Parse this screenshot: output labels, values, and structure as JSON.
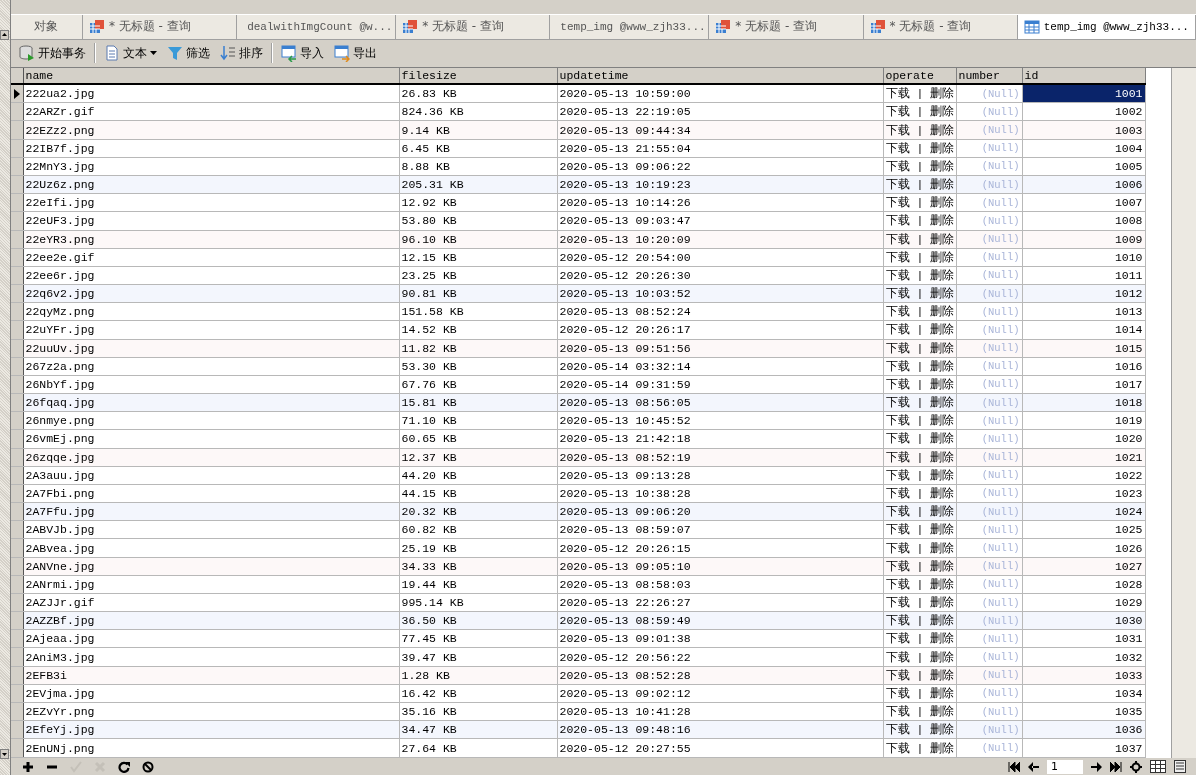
{
  "tabs": [
    {
      "kind": "object",
      "label": "对象",
      "selected": false
    },
    {
      "kind": "query",
      "label": "* 无标题 - 查询",
      "selected": false
    },
    {
      "kind": "function",
      "label": "dealwithImgCount @w...",
      "selected": false
    },
    {
      "kind": "query",
      "label": "* 无标题 - 查询",
      "selected": false
    },
    {
      "kind": "table",
      "label": "temp_img @www_zjh33...",
      "selected": false
    },
    {
      "kind": "query",
      "label": "* 无标题 - 查询",
      "selected": false
    },
    {
      "kind": "query",
      "label": "* 无标题 - 查询",
      "selected": false
    },
    {
      "kind": "table",
      "label": "temp_img @www_zjh33...",
      "selected": true
    }
  ],
  "toolbar": [
    {
      "kind": "transaction",
      "label": "开始事务"
    },
    {
      "kind": "text",
      "label": "文本"
    },
    {
      "kind": "filter",
      "label": "筛选"
    },
    {
      "kind": "sort",
      "label": "排序"
    },
    {
      "kind": "import",
      "label": "导入"
    },
    {
      "kind": "export",
      "label": "导出"
    }
  ],
  "table": {
    "columns": [
      "name",
      "filesize",
      "updatetime",
      "operate",
      "number",
      "id"
    ],
    "rows": [
      {
        "selected": true,
        "cells": [
          "222ua2.jpg",
          "26.83 KB",
          "2020-05-13 10:59:00",
          "下载 | 删除",
          "(Null)",
          "1001"
        ]
      },
      {
        "selected": false,
        "cells": [
          "22ARZr.gif",
          "824.36 KB",
          "2020-05-13 22:19:05",
          "下载 | 删除",
          "(Null)",
          "1002"
        ]
      },
      {
        "selected": false,
        "cells": [
          "22EZz2.png",
          "9.14 KB",
          "2020-05-13 09:44:34",
          "下载 | 删除",
          "(Null)",
          "1003"
        ]
      },
      {
        "selected": false,
        "cells": [
          "22IB7f.jpg",
          "6.45 KB",
          "2020-05-13 21:55:04",
          "下载 | 删除",
          "(Null)",
          "1004"
        ]
      },
      {
        "selected": false,
        "cells": [
          "22MnY3.jpg",
          "8.88 KB",
          "2020-05-13 09:06:22",
          "下载 | 删除",
          "(Null)",
          "1005"
        ]
      },
      {
        "selected": false,
        "cells": [
          "22Uz6z.png",
          "205.31 KB",
          "2020-05-13 10:19:23",
          "下载 | 删除",
          "(Null)",
          "1006"
        ]
      },
      {
        "selected": false,
        "cells": [
          "22eIfi.jpg",
          "12.92 KB",
          "2020-05-13 10:14:26",
          "下载 | 删除",
          "(Null)",
          "1007"
        ]
      },
      {
        "selected": false,
        "cells": [
          "22eUF3.jpg",
          "53.80 KB",
          "2020-05-13 09:03:47",
          "下载 | 删除",
          "(Null)",
          "1008"
        ]
      },
      {
        "selected": false,
        "cells": [
          "22eYR3.png",
          "96.10 KB",
          "2020-05-13 10:20:09",
          "下载 | 删除",
          "(Null)",
          "1009"
        ]
      },
      {
        "selected": false,
        "cells": [
          "22ee2e.gif",
          "12.15 KB",
          "2020-05-12 20:54:00",
          "下载 | 删除",
          "(Null)",
          "1010"
        ]
      },
      {
        "selected": false,
        "cells": [
          "22ee6r.jpg",
          "23.25 KB",
          "2020-05-12 20:26:30",
          "下载 | 删除",
          "(Null)",
          "1011"
        ]
      },
      {
        "selected": false,
        "cells": [
          "22q6v2.jpg",
          "90.81 KB",
          "2020-05-13 10:03:52",
          "下载 | 删除",
          "(Null)",
          "1012"
        ]
      },
      {
        "selected": false,
        "cells": [
          "22qyMz.png",
          "151.58 KB",
          "2020-05-13 08:52:24",
          "下载 | 删除",
          "(Null)",
          "1013"
        ]
      },
      {
        "selected": false,
        "cells": [
          "22uYFr.jpg",
          "14.52 KB",
          "2020-05-12 20:26:17",
          "下载 | 删除",
          "(Null)",
          "1014"
        ]
      },
      {
        "selected": false,
        "cells": [
          "22uuUv.jpg",
          "11.82 KB",
          "2020-05-13 09:51:56",
          "下载 | 删除",
          "(Null)",
          "1015"
        ]
      },
      {
        "selected": false,
        "cells": [
          "267z2a.png",
          "53.30 KB",
          "2020-05-14 03:32:14",
          "下载 | 删除",
          "(Null)",
          "1016"
        ]
      },
      {
        "selected": false,
        "cells": [
          "26NbYf.jpg",
          "67.76 KB",
          "2020-05-14 09:31:59",
          "下载 | 删除",
          "(Null)",
          "1017"
        ]
      },
      {
        "selected": false,
        "cells": [
          "26fqaq.jpg",
          "15.81 KB",
          "2020-05-13 08:56:05",
          "下载 | 删除",
          "(Null)",
          "1018"
        ]
      },
      {
        "selected": false,
        "cells": [
          "26nmye.png",
          "71.10 KB",
          "2020-05-13 10:45:52",
          "下载 | 删除",
          "(Null)",
          "1019"
        ]
      },
      {
        "selected": false,
        "cells": [
          "26vmEj.png",
          "60.65 KB",
          "2020-05-13 21:42:18",
          "下载 | 删除",
          "(Null)",
          "1020"
        ]
      },
      {
        "selected": false,
        "cells": [
          "26zqqe.jpg",
          "12.37 KB",
          "2020-05-13 08:52:19",
          "下载 | 删除",
          "(Null)",
          "1021"
        ]
      },
      {
        "selected": false,
        "cells": [
          "2A3auu.jpg",
          "44.20 KB",
          "2020-05-13 09:13:28",
          "下载 | 删除",
          "(Null)",
          "1022"
        ]
      },
      {
        "selected": false,
        "cells": [
          "2A7Fbi.png",
          "44.15 KB",
          "2020-05-13 10:38:28",
          "下载 | 删除",
          "(Null)",
          "1023"
        ]
      },
      {
        "selected": false,
        "cells": [
          "2A7Ffu.jpg",
          "20.32 KB",
          "2020-05-13 09:06:20",
          "下载 | 删除",
          "(Null)",
          "1024"
        ]
      },
      {
        "selected": false,
        "cells": [
          "2ABVJb.jpg",
          "60.82 KB",
          "2020-05-13 08:59:07",
          "下载 | 删除",
          "(Null)",
          "1025"
        ]
      },
      {
        "selected": false,
        "cells": [
          "2ABvea.jpg",
          "25.19 KB",
          "2020-05-12 20:26:15",
          "下载 | 删除",
          "(Null)",
          "1026"
        ]
      },
      {
        "selected": false,
        "cells": [
          "2ANVne.jpg",
          "34.33 KB",
          "2020-05-13 09:05:10",
          "下载 | 删除",
          "(Null)",
          "1027"
        ]
      },
      {
        "selected": false,
        "cells": [
          "2ANrmi.jpg",
          "19.44 KB",
          "2020-05-13 08:58:03",
          "下载 | 删除",
          "(Null)",
          "1028"
        ]
      },
      {
        "selected": false,
        "cells": [
          "2AZJJr.gif",
          "995.14 KB",
          "2020-05-13 22:26:27",
          "下载 | 删除",
          "(Null)",
          "1029"
        ]
      },
      {
        "selected": false,
        "cells": [
          "2AZZBf.jpg",
          "36.50 KB",
          "2020-05-13 08:59:49",
          "下载 | 删除",
          "(Null)",
          "1030"
        ]
      },
      {
        "selected": false,
        "cells": [
          "2Ajeaa.jpg",
          "77.45 KB",
          "2020-05-13 09:01:38",
          "下载 | 删除",
          "(Null)",
          "1031"
        ]
      },
      {
        "selected": false,
        "cells": [
          "2AniM3.jpg",
          "39.47 KB",
          "2020-05-12 20:56:22",
          "下载 | 删除",
          "(Null)",
          "1032"
        ]
      },
      {
        "selected": false,
        "cells": [
          "2EFB3i",
          "1.28 KB",
          "2020-05-13 08:52:28",
          "下载 | 删除",
          "(Null)",
          "1033"
        ]
      },
      {
        "selected": false,
        "cells": [
          "2EVjma.jpg",
          "16.42 KB",
          "2020-05-13 09:02:12",
          "下载 | 删除",
          "(Null)",
          "1034"
        ]
      },
      {
        "selected": false,
        "cells": [
          "2EZvYr.png",
          "35.16 KB",
          "2020-05-13 10:41:28",
          "下载 | 删除",
          "(Null)",
          "1035"
        ]
      },
      {
        "selected": false,
        "cells": [
          "2EfeYj.jpg",
          "34.47 KB",
          "2020-05-13 09:48:16",
          "下载 | 删除",
          "(Null)",
          "1036"
        ]
      },
      {
        "selected": false,
        "cells": [
          "2EnUNj.png",
          "27.64 KB",
          "2020-05-12 20:27:55",
          "下载 | 删除",
          "(Null)",
          "1037"
        ]
      }
    ]
  },
  "bottom_bar": {
    "actions": [
      {
        "kind": "add",
        "disabled": false
      },
      {
        "kind": "delete",
        "disabled": false
      },
      {
        "kind": "apply",
        "disabled": true
      },
      {
        "kind": "cancel",
        "disabled": true
      },
      {
        "kind": "refresh",
        "disabled": false
      },
      {
        "kind": "stop",
        "disabled": false
      }
    ],
    "page": "1"
  }
}
